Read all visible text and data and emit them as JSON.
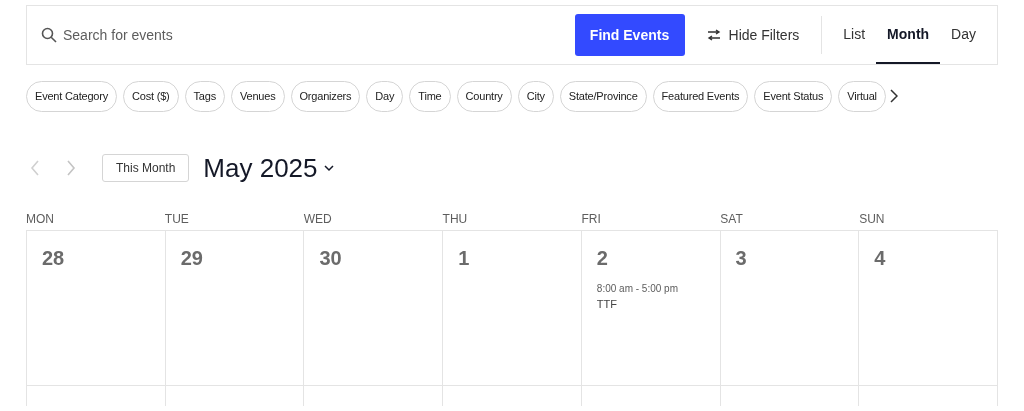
{
  "search": {
    "placeholder": "Search for events"
  },
  "find_button": "Find Events",
  "filters_toggle": "Hide Filters",
  "views": [
    {
      "label": "List",
      "selected": false
    },
    {
      "label": "Month",
      "selected": true
    },
    {
      "label": "Day",
      "selected": false
    }
  ],
  "filter_chips": [
    "Event Category",
    "Cost ($)",
    "Tags",
    "Venues",
    "Organizers",
    "Day",
    "Time",
    "Country",
    "City",
    "State/Province",
    "Featured Events",
    "Event Status",
    "Virtual"
  ],
  "nav": {
    "prev_disabled": true,
    "today_button": "This Month",
    "title": "May 2025"
  },
  "weekdays": [
    "MON",
    "TUE",
    "WED",
    "THU",
    "FRI",
    "SAT",
    "SUN"
  ],
  "weeks": [
    [
      {
        "day": "28"
      },
      {
        "day": "29"
      },
      {
        "day": "30"
      },
      {
        "day": "1"
      },
      {
        "day": "2",
        "events": [
          {
            "time": "8:00 am - 5:00 pm",
            "title": "TTF"
          }
        ]
      },
      {
        "day": "3"
      },
      {
        "day": "4"
      }
    ]
  ]
}
